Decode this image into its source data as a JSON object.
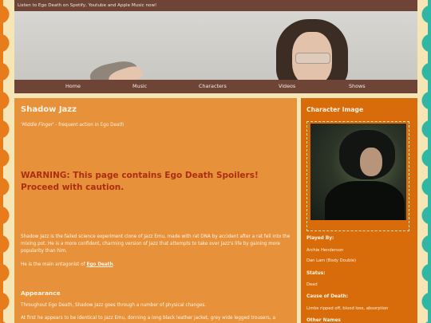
{
  "topbar": {
    "text": "Listen to Ego Death on Spotify, Youtube and Apple Music now!"
  },
  "nav": {
    "items": [
      "Home",
      "Music",
      "Characters",
      "Videos",
      "Shows"
    ]
  },
  "main": {
    "title": "Shadow Jazz",
    "quote": "'Middle Finger'",
    "quote_suffix": " - frequent action in Ego Death",
    "warning": "WARNING: This page contains Ego Death Spoilers! Proceed with caution.",
    "paragraph1": "Shadow Jazz is the failed science experiment clone of Jazz Emu, made with rat DNA by accident after a rat fell into the mixing pot. He is a more confident, charming version of Jazz that attempts to take over Jazz's life by gaining more popularity than him.",
    "paragraph2_prefix": "He is the main antagonist of ",
    "paragraph2_link": "Ego Death",
    "paragraph2_suffix": ".",
    "section_appearance": "Appearance",
    "paragraph3": "Throughout Ego Death, Shadow Jazz goes through a number of physical changes.",
    "paragraph4": "At first he appears to be identical to Jazz Emu, donning a long black leather jacket, grey wide legged trousers, a"
  },
  "side": {
    "heading": "Character Image",
    "played_by_label": "Played By:",
    "played_by_values": [
      "Archie Henderson",
      "Dan Lam (Body Double)"
    ],
    "status_label": "Status:",
    "status_value": "Dead",
    "cause_label": "Cause of Death:",
    "cause_value": "Limbs ripped off, blood loss, absorption",
    "other_names_label": "Other Names"
  },
  "colors": {
    "topbar": "#6d4436",
    "main_bg": "#e7923a",
    "side_bg": "#d86c0b",
    "warning": "#ad2d13",
    "left_scallop": "#e87b1a",
    "right_scallop": "#2fb7a4"
  }
}
